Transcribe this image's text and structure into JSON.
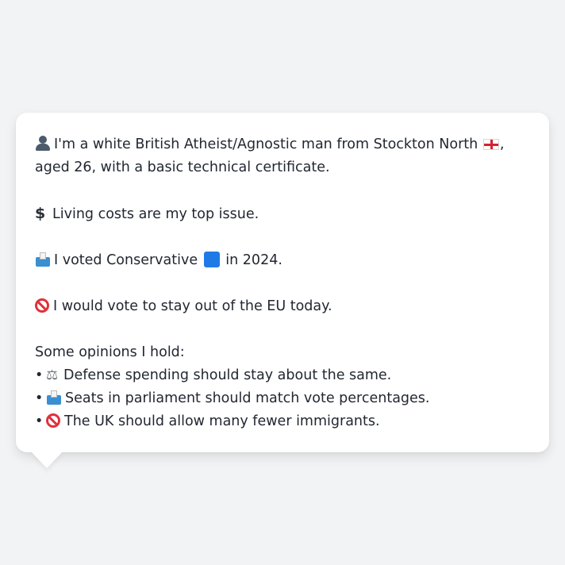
{
  "message": {
    "intro_prefix": "I'm a white British Atheist/Agnostic man from Stockton North",
    "intro_suffix": ", aged 26, with a basic technical certificate.",
    "top_issue": "Living costs are my top issue.",
    "voted_prefix": "I voted Conservative",
    "voted_suffix": "in 2024.",
    "eu_stance": "I would vote to stay out of the EU today.",
    "opinions_heading": "Some opinions I hold:",
    "bullet": "•",
    "opinions": [
      {
        "icon": "scales-icon",
        "text": "Defense spending should stay about the same."
      },
      {
        "icon": "ballot-box-icon",
        "text": "Seats in parliament should match vote percentages."
      },
      {
        "icon": "prohibited-icon",
        "text": "The UK should allow many fewer immigrants."
      }
    ]
  },
  "icons": {
    "person": "bust-in-silhouette-icon",
    "flag": "england-flag-icon",
    "dollar": "heavy-dollar-sign-icon",
    "ballot": "ballot-box-icon",
    "party_color": "blue-square-icon",
    "prohibited": "prohibited-icon"
  },
  "colors": {
    "background": "#f2f3f5",
    "bubble": "#ffffff",
    "text": "#222731",
    "party_blue": "#1f7ae6",
    "prohibited_red": "#e0313b"
  }
}
